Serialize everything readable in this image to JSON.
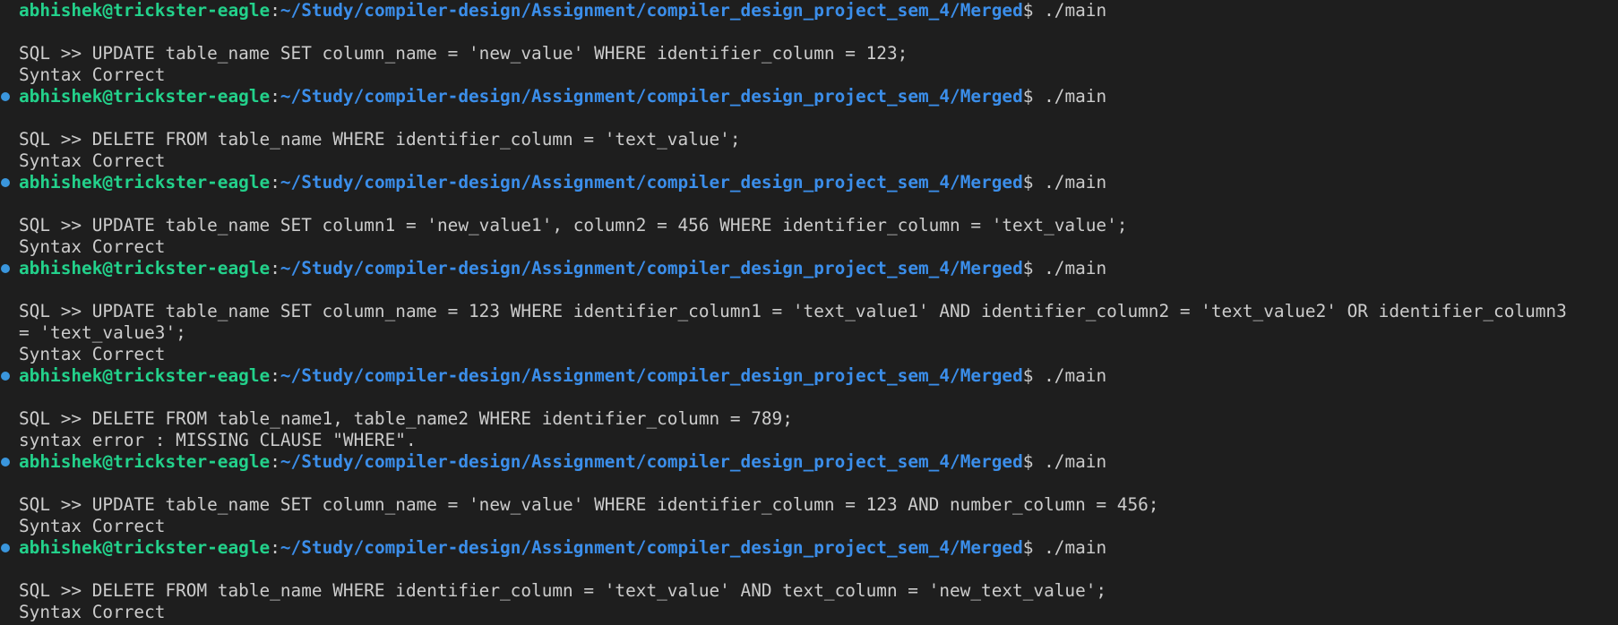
{
  "colors": {
    "background": "#1e1e1e",
    "foreground": "#cccccc",
    "user": "#23d18b",
    "path": "#3b8eea",
    "decoration_dot": "#3a96dd"
  },
  "prompt": {
    "user_host": "abhishek@trickster-eagle",
    "colon": ":",
    "path": "~/Study/compiler-design/Assignment/compiler_design_project_sem_4/Merged",
    "suffix": "$ ./main"
  },
  "blocks": [
    {
      "dot": false,
      "sql": "SQL >> UPDATE table_name SET column_name = 'new_value' WHERE identifier_column = 123;",
      "sql_cont": "",
      "output": "Syntax Correct"
    },
    {
      "dot": true,
      "sql": "SQL >> DELETE FROM table_name WHERE identifier_column = 'text_value';",
      "sql_cont": "",
      "output": "Syntax Correct"
    },
    {
      "dot": true,
      "sql": "SQL >> UPDATE table_name SET column1 = 'new_value1', column2 = 456 WHERE identifier_column = 'text_value';",
      "sql_cont": "",
      "output": "Syntax Correct"
    },
    {
      "dot": true,
      "sql": "SQL >> UPDATE table_name SET column_name = 123 WHERE identifier_column1 = 'text_value1' AND identifier_column2 = 'text_value2' OR identifier_column3",
      "sql_cont": "= 'text_value3';",
      "output": "Syntax Correct"
    },
    {
      "dot": true,
      "sql": "SQL >> DELETE FROM table_name1, table_name2 WHERE identifier_column = 789;",
      "sql_cont": "",
      "output": "syntax error : MISSING CLAUSE \"WHERE\"."
    },
    {
      "dot": true,
      "sql": "SQL >> UPDATE table_name SET column_name = 'new_value' WHERE identifier_column = 123 AND number_column = 456;",
      "sql_cont": "",
      "output": "Syntax Correct"
    },
    {
      "dot": true,
      "sql": "SQL >> DELETE FROM table_name WHERE identifier_column = 'text_value' AND text_column = 'new_text_value';",
      "sql_cont": "",
      "output": "Syntax Correct"
    }
  ]
}
